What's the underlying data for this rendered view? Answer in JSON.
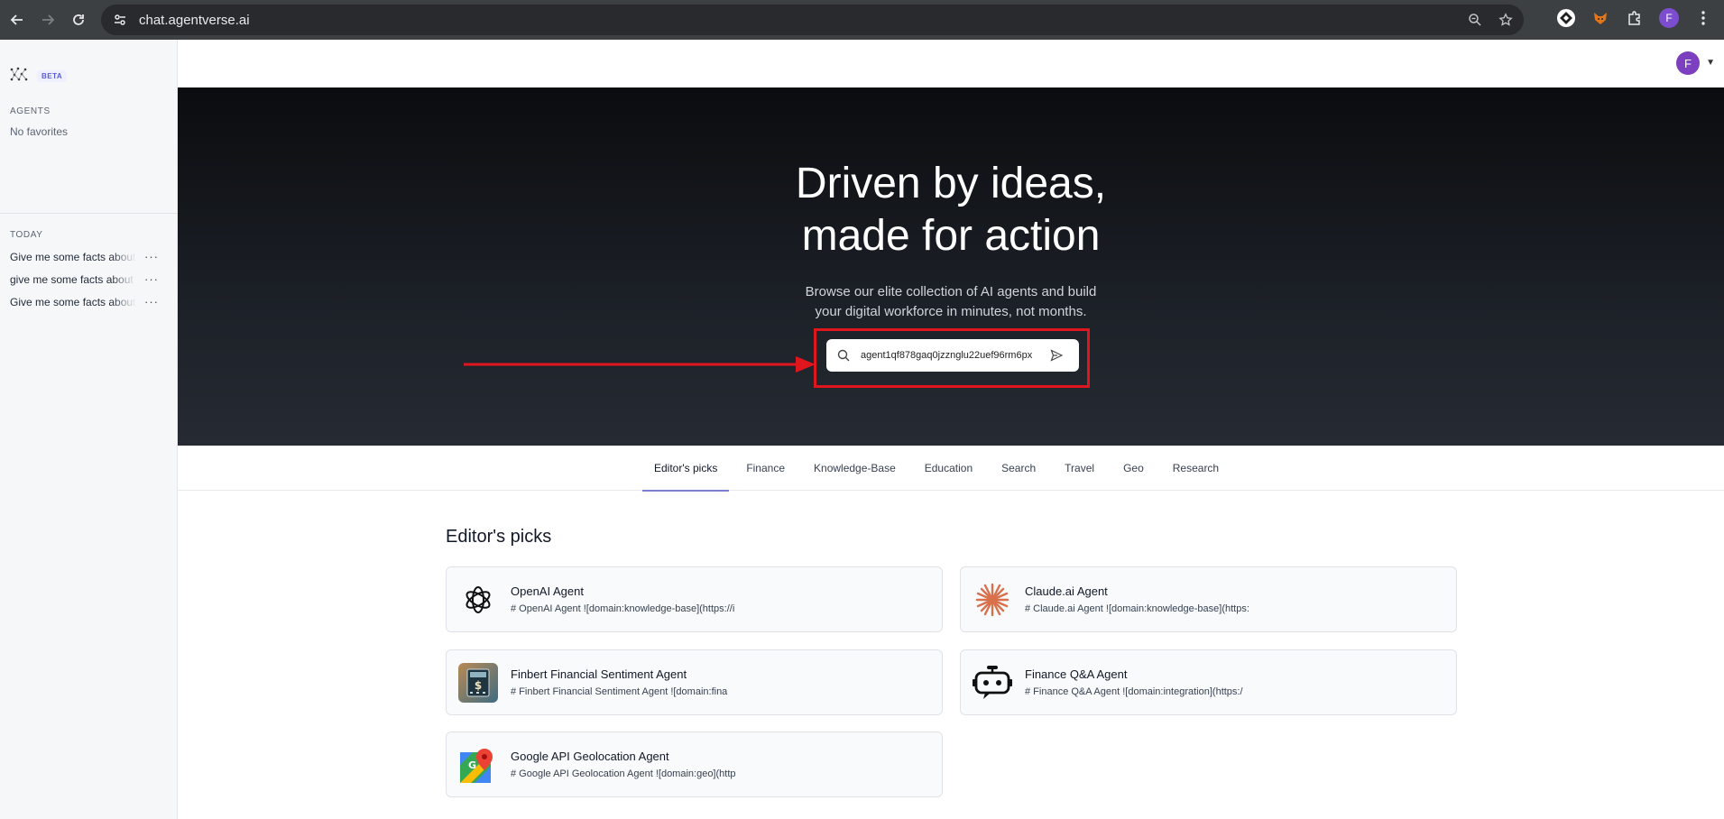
{
  "browser": {
    "url": "chat.agentverse.ai",
    "profile_initial": "F"
  },
  "sidebar": {
    "beta_label": "BETA",
    "agents_label": "AGENTS",
    "no_favorites": "No favorites",
    "today_label": "TODAY",
    "chats": [
      {
        "title": "Give me some facts about"
      },
      {
        "title": "give me some facts about"
      },
      {
        "title": "Give me some facts about"
      }
    ],
    "more_label": "···"
  },
  "header": {
    "user_initial": "F"
  },
  "hero": {
    "title_line1": "Driven by ideas,",
    "title_line2": "made for action",
    "subtitle_line1": "Browse our elite collection of AI agents and build",
    "subtitle_line2": "your digital workforce in minutes, not months.",
    "search_value": "agent1qf878gaq0jzznglu22uef96rm6px"
  },
  "tabs": [
    {
      "label": "Editor's picks",
      "active": true
    },
    {
      "label": "Finance"
    },
    {
      "label": "Knowledge-Base"
    },
    {
      "label": "Education"
    },
    {
      "label": "Search"
    },
    {
      "label": "Travel"
    },
    {
      "label": "Geo"
    },
    {
      "label": "Research"
    }
  ],
  "picks": {
    "title": "Editor's picks",
    "cards": [
      {
        "name": "OpenAI Agent",
        "desc": "# OpenAI Agent ![domain:knowledge-base](https://i",
        "icon": "openai-logo-icon"
      },
      {
        "name": "Claude.ai Agent",
        "desc": "# Claude.ai Agent ![domain:knowledge-base](https:",
        "icon": "claude-logo-icon"
      },
      {
        "name": "Finbert Financial Sentiment Agent",
        "desc": "# Finbert Financial Sentiment Agent ![domain:fina",
        "icon": "finance-calculator-icon"
      },
      {
        "name": "Finance Q&A Agent",
        "desc": "# Finance Q&A Agent ![domain:integration](https:/",
        "icon": "robot-chat-icon"
      },
      {
        "name": "Google API Geolocation Agent",
        "desc": "# Google API Geolocation Agent ![domain:geo](http",
        "icon": "google-maps-icon"
      }
    ]
  },
  "colors": {
    "accent": "#7a7fd1",
    "highlight_red": "#e0161f",
    "hero_bg": "#0b0c0f"
  }
}
